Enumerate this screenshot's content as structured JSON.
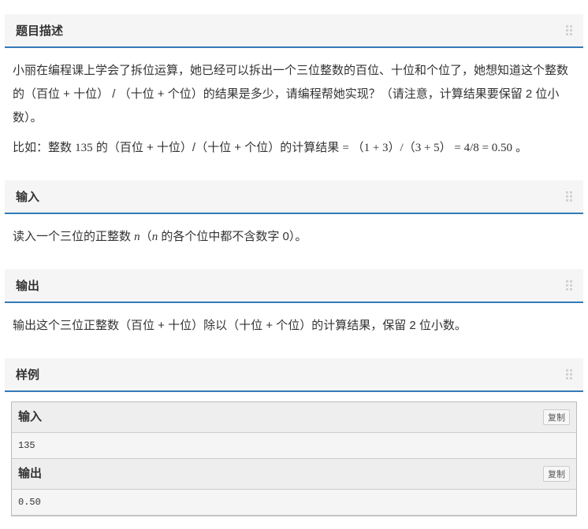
{
  "sections": {
    "description": {
      "title": "题目描述",
      "para1": "小丽在编程课上学会了拆位运算，她已经可以拆出一个三位整数的百位、十位和个位了，她想知道这个整数的（百位 + 十位） / （十位 + 个位）的结果是多少，请编程帮她实现？（请注意，计算结果要保留 2 位小数）。",
      "para2_pre": "比如：整数 ",
      "para2_num": "135",
      "para2_mid": " 的（百位 + 十位）/（十位 + 个位）的计算结果 ",
      "para2_math": "= （1 + 3）/（3 + 5） = 4/8 = 0.50",
      "para2_post": " 。"
    },
    "input": {
      "title": "输入",
      "text_pre": "读入一个三位的正整数 ",
      "var": "n",
      "text_mid": "（",
      "var2": "n",
      "text_post": " 的各个位中都不含数字 0）。"
    },
    "output": {
      "title": "输出",
      "text": "输出这个三位正整数（百位 + 十位）除以（十位 + 个位）的计算结果，保留 2 位小数。"
    },
    "sample": {
      "title": "样例",
      "input_label": "输入",
      "output_label": "输出",
      "copy_label": "复制",
      "input_value": "135",
      "output_value": "0.50"
    }
  }
}
